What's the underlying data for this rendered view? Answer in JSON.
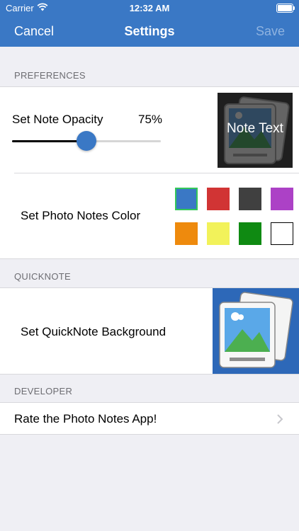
{
  "status": {
    "carrier": "Carrier",
    "time": "12:32 AM"
  },
  "nav": {
    "cancel": "Cancel",
    "title": "Settings",
    "save": "Save"
  },
  "sections": {
    "preferences": "PREFERENCES",
    "quicknote": "QUICKNOTE",
    "developer": "DEVELOPER"
  },
  "preferences": {
    "opacity_label": "Set Note Opacity",
    "opacity_value": "75%",
    "opacity_fraction": 0.5,
    "preview_text": "Note Text",
    "color_label": "Set Photo Notes Color",
    "colors": [
      "#3a78c5",
      "#d13434",
      "#404040",
      "#ac41c6",
      "#ee8a0d",
      "#f2f25a",
      "#0f8a12",
      "#ffffff"
    ],
    "selected_color": "#3a78c5"
  },
  "quicknote": {
    "background_label": "Set QuickNote Background"
  },
  "developer": {
    "rate_label": "Rate the Photo Notes App!"
  }
}
